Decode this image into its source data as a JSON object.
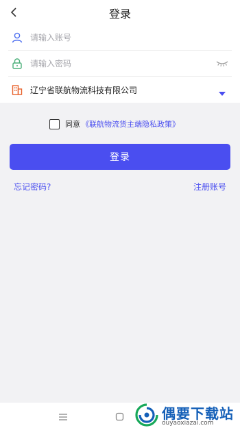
{
  "header": {
    "title": "登录"
  },
  "form": {
    "account_placeholder": "请输入账号",
    "password_placeholder": "请输入密码",
    "company": "辽宁省联航物流科技有限公司"
  },
  "agreement": {
    "prefix": "同意",
    "policy_link": "《联航物流货主端隐私政策》"
  },
  "login_button": "登录",
  "links": {
    "forgot_password": "忘记密码?",
    "register": "注册账号"
  },
  "watermark": {
    "title": "偶要下载站",
    "url": "ouyaoxiazai.com"
  },
  "colors": {
    "accent": "#4a4ef0",
    "background": "#f2f2f4",
    "company_icon": "#e8622c",
    "lock_icon": "#4caf7a",
    "user_icon": "#4a6cf0"
  },
  "icons": {
    "back": "chevron-left-icon",
    "user": "user-icon",
    "lock": "lock-icon",
    "eye": "eye-closed-icon",
    "company": "building-icon",
    "dropdown": "caret-down-icon",
    "nav_menu": "menu-icon",
    "nav_home": "home-square-icon"
  }
}
